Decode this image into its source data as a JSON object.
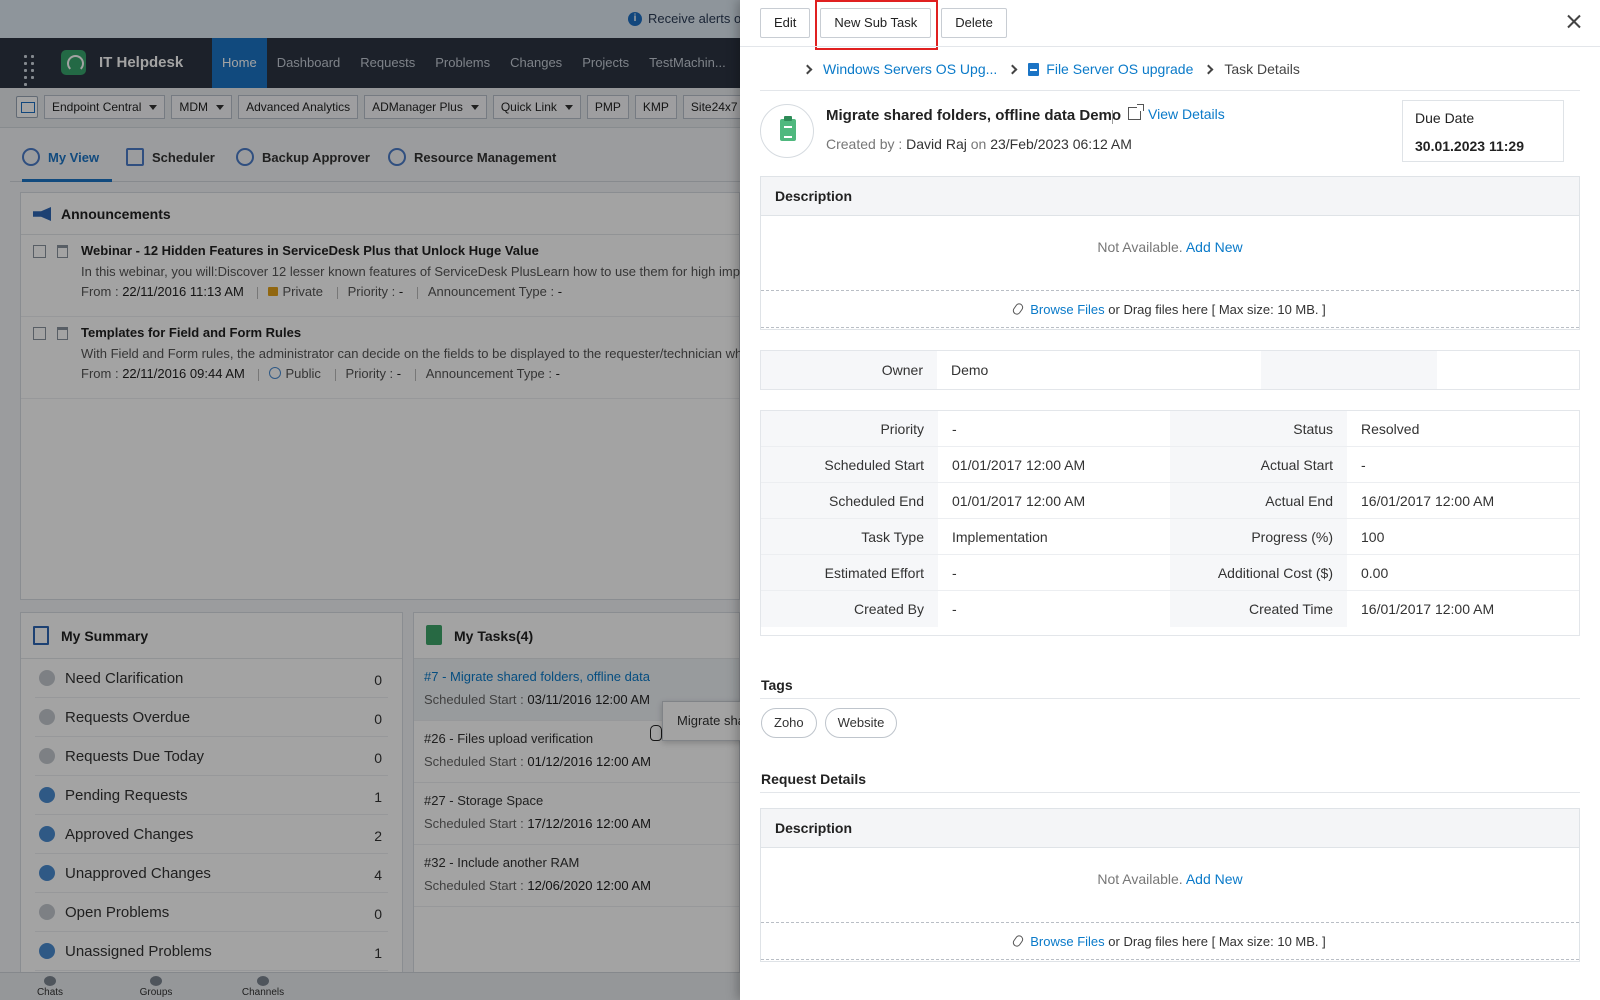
{
  "bg": {
    "alert_text": "Receive alerts o",
    "app_name": "IT Helpdesk",
    "nav_tabs": [
      "Home",
      "Dashboard",
      "Requests",
      "Problems",
      "Changes",
      "Projects",
      "TestMachin..."
    ],
    "toolbar_items": [
      {
        "label": "Endpoint Central",
        "dropdown": true
      },
      {
        "label": "MDM",
        "dropdown": true
      },
      {
        "label": "Advanced Analytics",
        "dropdown": false
      },
      {
        "label": "ADManager Plus",
        "dropdown": true
      },
      {
        "label": "Quick Link",
        "dropdown": true
      },
      {
        "label": "PMP",
        "dropdown": false
      },
      {
        "label": "KMP",
        "dropdown": false
      },
      {
        "label": "Site24x7",
        "dropdown": false
      }
    ],
    "view_tabs": [
      "My View",
      "Scheduler",
      "Backup Approver",
      "Resource Management"
    ],
    "announcements": {
      "title": "Announcements",
      "items": [
        {
          "title": "Webinar - 12 Hidden Features in ServiceDesk Plus that Unlock Huge Value",
          "desc": "In this webinar, you will:Discover 12 lesser known features of ServiceDesk PlusLearn how to use them for high impact",
          "from_label": "From :",
          "from": "22/11/2016 11:13 AM",
          "visibility": "Private",
          "priority_label": "Priority :",
          "priority": "-",
          "type_label": "Announcement Type :",
          "type": "-"
        },
        {
          "title": "Templates for Field and Form Rules",
          "desc": "With Field and Form rules, the administrator can decide on the fields to be displayed to the requester/technician while",
          "from_label": "From :",
          "from": "22/11/2016 09:44 AM",
          "visibility": "Public",
          "priority_label": "Priority :",
          "priority": "-",
          "type_label": "Announcement Type :",
          "type": "-"
        }
      ]
    },
    "summary": {
      "title": "My Summary",
      "rows": [
        {
          "label": "Need Clarification",
          "count": "0"
        },
        {
          "label": "Requests Overdue",
          "count": "0"
        },
        {
          "label": "Requests Due Today",
          "count": "0"
        },
        {
          "label": "Pending Requests",
          "count": "1"
        },
        {
          "label": "Approved Changes",
          "count": "2"
        },
        {
          "label": "Unapproved Changes",
          "count": "4"
        },
        {
          "label": "Open Problems",
          "count": "0"
        },
        {
          "label": "Unassigned Problems",
          "count": "1"
        }
      ]
    },
    "tasks": {
      "title": "My Tasks(4)",
      "sched_label": "Scheduled Start :",
      "rows": [
        {
          "title": "#7 - Migrate shared folders, offline data",
          "start": "03/11/2016 12:00 AM"
        },
        {
          "title": "#26 - Files upload verification",
          "start": "01/12/2016 12:00 AM"
        },
        {
          "title": "#27 - Storage Space",
          "start": "17/12/2016 12:00 AM"
        },
        {
          "title": "#32 - Include another RAM",
          "start": "12/06/2020 12:00 AM"
        }
      ],
      "tooltip": "Migrate shared folders, offline data"
    },
    "bottom_bar": [
      "Chats",
      "Groups",
      "Channels"
    ]
  },
  "panel": {
    "actions": {
      "edit": "Edit",
      "new_sub_task": "New Sub Task",
      "delete": "Delete"
    },
    "breadcrumb": {
      "item1": "Windows Servers OS Upg...",
      "item2": "File Server OS upgrade",
      "current": "Task Details"
    },
    "task": {
      "name": "Migrate shared folders, offline data Demo",
      "view_details": "View Details",
      "created_by_label": "Created by :",
      "created_by": "David Raj",
      "on_label": "on",
      "created_on": "23/Feb/2023 06:12 AM",
      "due_label": "Due Date",
      "due_value": "30.01.2023 11:29"
    },
    "description": {
      "header": "Description",
      "empty": "Not Available.",
      "add_new": "Add New",
      "browse": "Browse Files",
      "drag_text": "or Drag files here [ Max size: 10 MB. ]"
    },
    "owner": {
      "label": "Owner",
      "value": "Demo"
    },
    "properties": [
      {
        "k1": "Priority",
        "v1": "-",
        "k2": "Status",
        "v2": "Resolved"
      },
      {
        "k1": "Scheduled Start",
        "v1": "01/01/2017 12:00 AM",
        "k2": "Actual Start",
        "v2": "-"
      },
      {
        "k1": "Scheduled End",
        "v1": "01/01/2017 12:00 AM",
        "k2": "Actual End",
        "v2": "16/01/2017 12:00 AM"
      },
      {
        "k1": "Task Type",
        "v1": "Implementation",
        "k2": "Progress (%)",
        "v2": "100"
      },
      {
        "k1": "Estimated Effort",
        "v1": "-",
        "k2": "Additional Cost ($)",
        "v2": "0.00"
      },
      {
        "k1": "Created By",
        "v1": "-",
        "k2": "Created Time",
        "v2": "16/01/2017 12:00 AM"
      }
    ],
    "tags": {
      "title": "Tags",
      "items": [
        "Zoho",
        "Website"
      ]
    },
    "request_details": {
      "title": "Request Details",
      "header": "Description",
      "empty": "Not Available.",
      "add_new": "Add New",
      "browse": "Browse Files",
      "drag_text": "or Drag files here [ Max size: 10 MB. ]"
    },
    "colors": {
      "accent": "#0a7ac9",
      "nav_active": "#1b74c5",
      "highlight": "#e02020"
    }
  }
}
